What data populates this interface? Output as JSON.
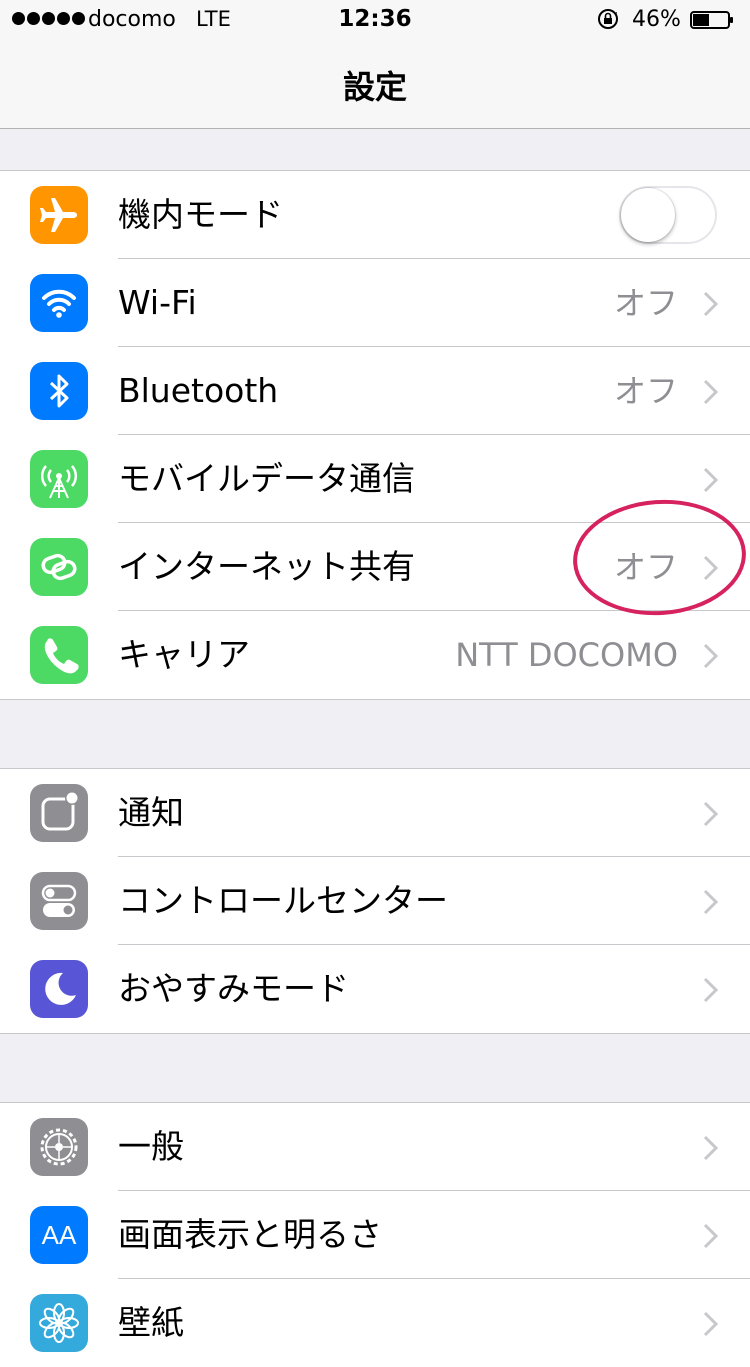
{
  "status_bar": {
    "carrier": "docomo",
    "network": "LTE",
    "time": "12:36",
    "battery_percent": "46%",
    "battery_level": 0.46,
    "signal_bars": 5
  },
  "nav": {
    "title": "設定"
  },
  "colors": {
    "airplane": "#ff9500",
    "wifi": "#007aff",
    "bluetooth": "#007aff",
    "cellular": "#4cd964",
    "hotspot": "#4cd964",
    "carrier": "#4cd964",
    "notifications": "#8e8e93",
    "control_center": "#8e8e93",
    "dnd": "#5856d6",
    "general": "#8e8e93",
    "display": "#007aff",
    "wallpaper": "#34aadc",
    "annotation": "#d6235f"
  },
  "group1": {
    "airplane": {
      "label": "機内モード",
      "icon": "airplane-icon",
      "toggle_on": false
    },
    "wifi": {
      "label": "Wi-Fi",
      "value": "オフ",
      "icon": "wifi-icon"
    },
    "bluetooth": {
      "label": "Bluetooth",
      "value": "オフ",
      "icon": "bluetooth-icon"
    },
    "cellular": {
      "label": "モバイルデータ通信",
      "icon": "antenna-icon"
    },
    "hotspot": {
      "label": "インターネット共有",
      "value": "オフ",
      "icon": "chain-link-icon"
    },
    "carrier": {
      "label": "キャリア",
      "value": "NTT DOCOMO",
      "icon": "phone-icon"
    }
  },
  "group2": {
    "notifications": {
      "label": "通知",
      "icon": "notification-icon"
    },
    "control_center": {
      "label": "コントロールセンター",
      "icon": "toggles-icon"
    },
    "dnd": {
      "label": "おやすみモード",
      "icon": "moon-icon"
    }
  },
  "group3": {
    "general": {
      "label": "一般",
      "icon": "gear-icon"
    },
    "display": {
      "label": "画面表示と明るさ",
      "icon": "text-size-icon",
      "icon_text": "AA"
    },
    "wallpaper": {
      "label": "壁紙",
      "icon": "flower-icon"
    }
  }
}
